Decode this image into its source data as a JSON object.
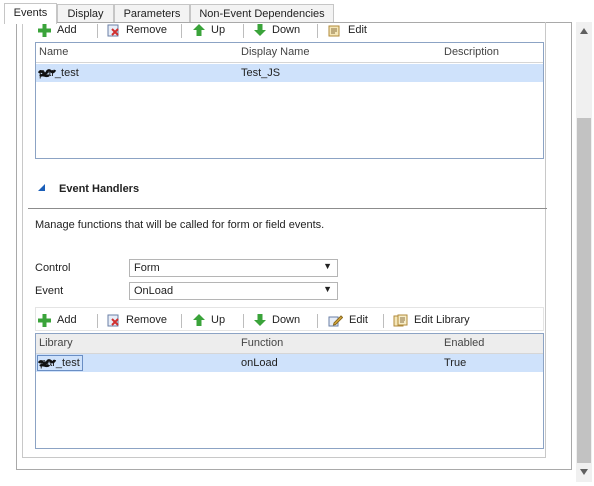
{
  "tabs": [
    "Events",
    "Display",
    "Parameters",
    "Non-Event Dependencies"
  ],
  "toolbar_libraries": {
    "add": "Add",
    "remove": "Remove",
    "up": "Up",
    "down": "Down",
    "edit": "Edit"
  },
  "libraries_grid": {
    "columns": [
      "Name",
      "Display Name",
      "Description"
    ],
    "rows": [
      {
        "name": "par_test",
        "display_name": "Test_JS",
        "description": ""
      }
    ]
  },
  "event_handlers": {
    "title": "Event Handlers",
    "description": "Manage functions that will be called for form or field events.",
    "control_label": "Control",
    "control_value": "Form",
    "event_label": "Event",
    "event_value": "OnLoad"
  },
  "toolbar_handlers": {
    "add": "Add",
    "remove": "Remove",
    "up": "Up",
    "down": "Down",
    "edit": "Edit",
    "edit_library": "Edit Library"
  },
  "handlers_grid": {
    "columns": [
      "Library",
      "Function",
      "Enabled"
    ],
    "rows": [
      {
        "library": "par_test",
        "function": "onLoad",
        "enabled": "True"
      }
    ]
  }
}
